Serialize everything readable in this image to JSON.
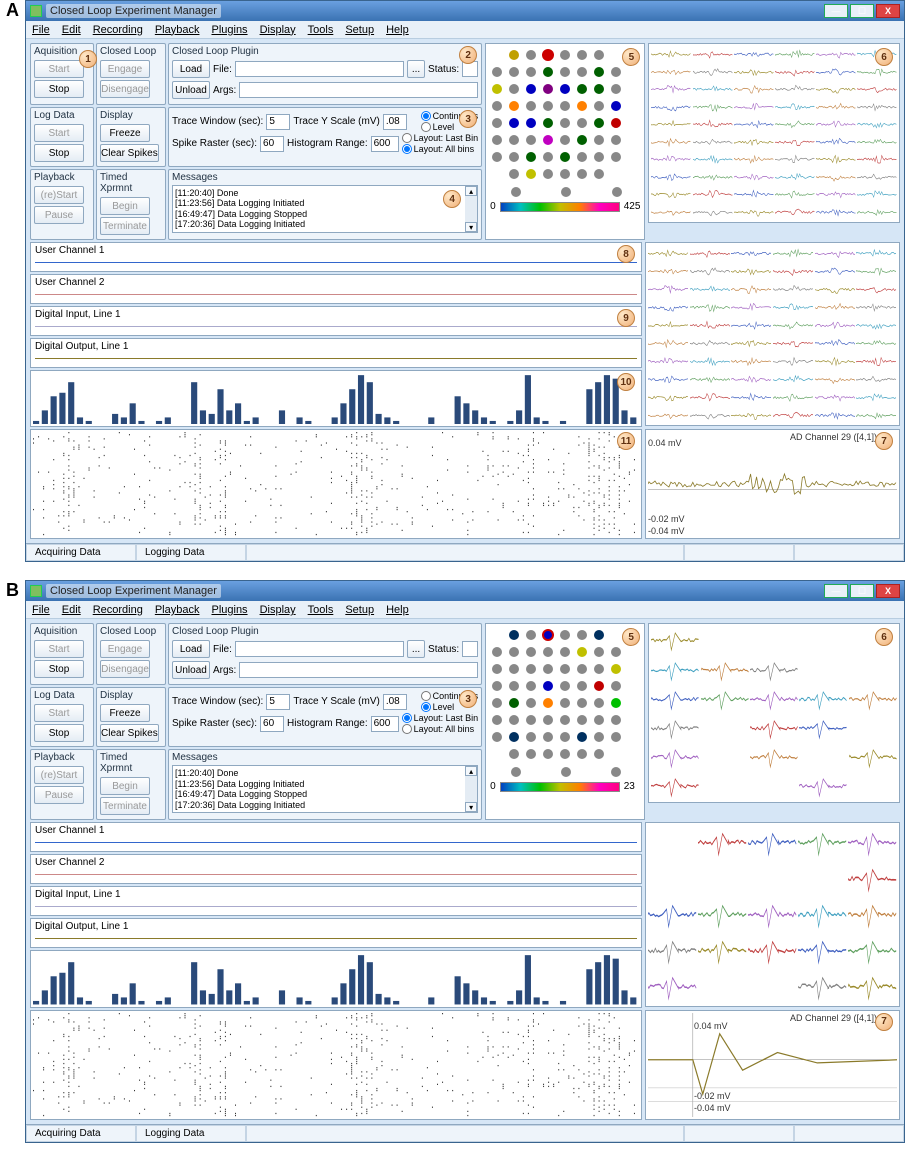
{
  "figures": {
    "A": {
      "callouts": {
        "c1": "1",
        "c2": "2",
        "c3": "3",
        "c4": "4",
        "c5": "5",
        "c6": "6",
        "c7": "7",
        "c8": "8",
        "c9": "9",
        "c10": "10",
        "c11": "11"
      },
      "meagrid_max": "425",
      "radios": {
        "continuous": true,
        "level": false,
        "last_bin": false,
        "all_bins": true
      }
    },
    "B": {
      "callouts": {
        "c3": "3",
        "c5": "5",
        "c6": "6",
        "c7": "7"
      },
      "meagrid_max": "23",
      "radios": {
        "continuous": false,
        "level": true,
        "last_bin": true,
        "all_bins": false
      }
    }
  },
  "title": "Closed Loop Experiment Manager",
  "menu": [
    "File",
    "Edit",
    "Recording",
    "Playback",
    "Plugins",
    "Display",
    "Tools",
    "Setup",
    "Help"
  ],
  "groups": {
    "aquisition": {
      "label": "Aquisition",
      "start": "Start",
      "stop": "Stop"
    },
    "closed_loop": {
      "label": "Closed Loop",
      "engage": "Engage",
      "disengage": "Disengage"
    },
    "log_data": {
      "label": "Log Data",
      "start": "Start",
      "stop": "Stop"
    },
    "display": {
      "label": "Display",
      "freeze": "Freeze",
      "clear": "Clear Spikes"
    },
    "playback": {
      "label": "Playback",
      "restart": "(re)Start",
      "pause": "Pause"
    },
    "timed": {
      "label": "Timed Xprmnt",
      "begin": "Begin",
      "terminate": "Terminate"
    },
    "plugin": {
      "label": "Closed Loop Plugin",
      "load": "Load",
      "unload": "Unload",
      "file_label": "File:",
      "args_label": "Args:",
      "file": "",
      "args": "",
      "dots": "...",
      "status_label": "Status:",
      "status": ""
    },
    "params": {
      "trace_win_label": "Trace Window (sec):",
      "trace_win": "5",
      "trace_y_label": "Trace Y Scale (mV)",
      "trace_y": ".08",
      "spike_raster_label": "Spike Raster (sec):",
      "spike_raster": "60",
      "hist_range_label": "Histogram Range:",
      "hist_range": "600",
      "continuous": "Continuous",
      "level": "Level",
      "last_bin": "Layout: Last Bin",
      "all_bins": "Layout: All bins"
    },
    "messages": {
      "label": "Messages",
      "lines": [
        "[11:20:40] Done",
        "[11:23:56] Data Logging Initiated",
        "[16:49:47] Data Logging Stopped",
        "[17:20:36] Data Logging Initiated"
      ]
    }
  },
  "channels": {
    "uc1": "User Channel 1",
    "uc2": "User Channel 2",
    "di1": "Digital Input, Line 1",
    "do1": "Digital Output, Line 1"
  },
  "single_channel": {
    "title": "AD Channel 29 ([4,1])",
    "y1": "0.04 mV",
    "y2": "-0.02 mV",
    "y3": "-0.04 mV"
  },
  "meagrid_min": "0",
  "status": {
    "acquiring": "Acquiring Data",
    "logging": "Logging Data"
  },
  "fig_letters": {
    "A": "A",
    "B": "B"
  },
  "win_buttons": {
    "min": "—",
    "max": "☐",
    "close": "X"
  },
  "chart_data": {
    "type": "bar",
    "note": "Spike histogram bins across ~30s window",
    "bins": [
      1,
      4,
      8,
      9,
      12,
      2,
      1,
      0,
      0,
      3,
      2,
      6,
      1,
      0,
      1,
      2,
      0,
      0,
      12,
      4,
      3,
      10,
      4,
      6,
      1,
      2,
      0,
      0,
      4,
      0,
      2,
      1,
      0,
      0,
      2,
      6,
      10,
      14,
      12,
      3,
      2,
      1,
      0,
      0,
      0,
      2,
      0,
      0,
      8,
      6,
      4,
      2,
      1,
      0,
      1,
      4,
      14,
      2,
      1,
      0,
      1,
      0,
      0,
      10,
      12,
      14,
      13,
      4,
      2
    ]
  },
  "mea_colors_A": [
    "",
    "#c0a000",
    "#888",
    "#c00",
    "#888",
    "#888",
    "#888",
    "",
    "#888",
    "#888",
    "#888",
    "#006000",
    "#888",
    "#888",
    "#006000",
    "#888",
    "#c0c000",
    "#888",
    "#0000c0",
    "#800080",
    "#0000c0",
    "#006000",
    "#006000",
    "#888",
    "#888",
    "#ff8000",
    "#888",
    "#888",
    "#888",
    "#ff8000",
    "#888",
    "#0000c0",
    "#888",
    "#0000c0",
    "#0000c0",
    "#006000",
    "#888",
    "#888",
    "#006000",
    "#c00000",
    "#888",
    "#888",
    "#888",
    "#c000c0",
    "#888",
    "#006000",
    "#888",
    "#888",
    "#888",
    "#888",
    "#006000",
    "#888",
    "#006000",
    "#888",
    "#888",
    "#888",
    "",
    "#888",
    "#c0c000",
    "#888",
    "#888",
    "#888",
    "#888",
    ""
  ],
  "mea_colors_B": [
    "",
    "#003060",
    "#888",
    "#0000c0",
    "#888",
    "#888",
    "#003060",
    "",
    "#888",
    "#888",
    "#888",
    "#888",
    "#888",
    "#c0c000",
    "#888",
    "#888",
    "#888",
    "#888",
    "#888",
    "#888",
    "#888",
    "#888",
    "#888",
    "#c0c000",
    "#888",
    "#888",
    "#888",
    "#0000c0",
    "#888",
    "#888",
    "#c00000",
    "#888",
    "#888",
    "#006000",
    "#888",
    "#ff8000",
    "#888",
    "#888",
    "#888",
    "#00c000",
    "#888",
    "#888",
    "#888",
    "#888",
    "#888",
    "#888",
    "#888",
    "#888",
    "#888",
    "#003060",
    "#888",
    "#888",
    "#888",
    "#003060",
    "#888",
    "#888",
    "",
    "#888",
    "#888",
    "#888",
    "#888",
    "#888",
    "#888",
    ""
  ],
  "trace_colors": [
    "#9a8a2a",
    "#c04040",
    "#4060c0",
    "#60a060",
    "#a060c0",
    "#40a0c0",
    "#c08040",
    "#808080"
  ]
}
